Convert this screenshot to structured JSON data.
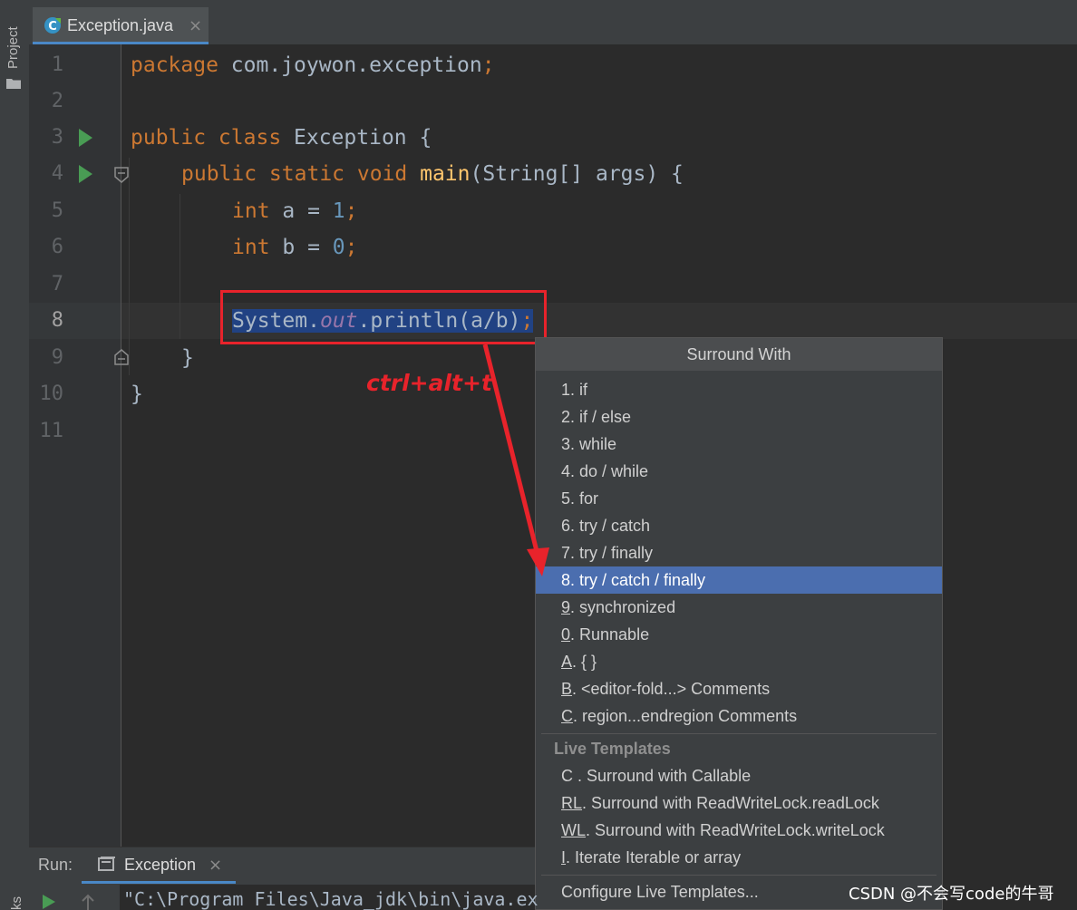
{
  "sidebar": {
    "project_label": "Project",
    "bottom_label": "ks"
  },
  "editor": {
    "tab_label": "Exception.java",
    "tab_close": "×",
    "line_numbers": [
      "1",
      "2",
      "3",
      "4",
      "5",
      "6",
      "7",
      "8",
      "9",
      "10",
      "11"
    ],
    "code": {
      "l1_kw": "package",
      "l1_rest": " com.joywon.exception",
      "l1_semi": ";",
      "l3_kw": "public class",
      "l3_rest": " Exception {",
      "l4_kw": "public static void",
      "l4_fn": "main",
      "l4_rest": "(String[] args) {",
      "l5_kw": "int",
      "l5_rest": " a = ",
      "l5_num": "1",
      "l5_semi": ";",
      "l6_kw": "int",
      "l6_rest": " b = ",
      "l6_num": "0",
      "l6_semi": ";",
      "l8_a": "System.",
      "l8_field": "out",
      "l8_b": ".println(a/b)",
      "l8_semi": ";",
      "l9": "}",
      "l10": "}"
    }
  },
  "annotation": {
    "shortcut": "ctrl+alt+t",
    "color": "#e8232b"
  },
  "popup": {
    "title": "Surround With",
    "items": [
      {
        "mn": "",
        "text": "1. if"
      },
      {
        "mn": "",
        "text": "2. if / else"
      },
      {
        "mn": "",
        "text": "3. while"
      },
      {
        "mn": "",
        "text": "4. do / while"
      },
      {
        "mn": "",
        "text": "5. for"
      },
      {
        "mn": "",
        "text": "6. try / catch"
      },
      {
        "mn": "",
        "text": "7. try / finally"
      },
      {
        "mn": "",
        "text": "8. try / catch / finally"
      },
      {
        "mn": "9",
        "text": ". synchronized"
      },
      {
        "mn": "0",
        "text": ". Runnable"
      },
      {
        "mn": "A",
        "text": ". { }"
      },
      {
        "mn": "B",
        "text": ". <editor-fold...> Comments"
      },
      {
        "mn": "C",
        "text": ". region...endregion Comments"
      }
    ],
    "selected_index": 7,
    "live_templates_label": "Live Templates",
    "live_items": [
      {
        "mn": "",
        "text": "C . Surround with Callable"
      },
      {
        "mn": "RL",
        "text": ". Surround with ReadWriteLock.readLock"
      },
      {
        "mn": "WL",
        "text": ". Surround with ReadWriteLock.writeLock"
      },
      {
        "mn": "I",
        "text": ". Iterate Iterable or array"
      }
    ],
    "configure_label": "Configure Live Templates..."
  },
  "run_panel": {
    "label": "Run:",
    "tab_label": "Exception",
    "tab_close": "×",
    "console_text": "\"C:\\Program Files\\Java_jdk\\bin\\java.ex"
  },
  "watermark": "CSDN @不会写code的牛哥",
  "colors": {
    "accent": "#4a88c7",
    "selection": "#4b6eaf",
    "keyword": "#cc7832",
    "number": "#6897bb"
  }
}
